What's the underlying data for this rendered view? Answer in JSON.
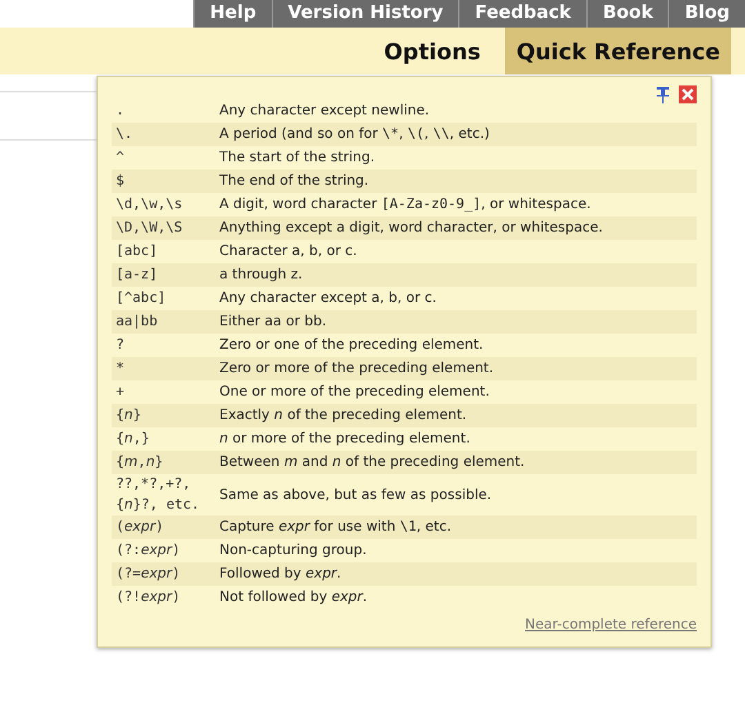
{
  "nav": [
    {
      "label": "Help"
    },
    {
      "label": "Version History"
    },
    {
      "label": "Feedback"
    },
    {
      "label": "Book"
    },
    {
      "label": "Blog"
    }
  ],
  "tabs": [
    {
      "label": "Options",
      "selected": false
    },
    {
      "label": "Quick Reference",
      "selected": true
    }
  ],
  "reference": {
    "rows": [
      {
        "pattern": [
          {
            "text": "."
          }
        ],
        "description": [
          {
            "text": "Any character except newline."
          }
        ]
      },
      {
        "pattern": [
          {
            "text": "\\."
          }
        ],
        "description": [
          {
            "text": "A period (and so on for "
          },
          {
            "text": "\\*",
            "code": true
          },
          {
            "text": ", "
          },
          {
            "text": "\\(",
            "code": true
          },
          {
            "text": ", "
          },
          {
            "text": "\\\\",
            "code": true
          },
          {
            "text": ", etc.)"
          }
        ]
      },
      {
        "pattern": [
          {
            "text": "^"
          }
        ],
        "description": [
          {
            "text": "The start of the string."
          }
        ]
      },
      {
        "pattern": [
          {
            "text": "$"
          }
        ],
        "description": [
          {
            "text": "The end of the string."
          }
        ]
      },
      {
        "pattern": [
          {
            "text": "\\d,\\w,\\s"
          }
        ],
        "description": [
          {
            "text": "A digit, word character "
          },
          {
            "text": "[A-Za-z0-9_]",
            "code": true
          },
          {
            "text": ", or whitespace."
          }
        ]
      },
      {
        "pattern": [
          {
            "text": "\\D,\\W,\\S"
          }
        ],
        "description": [
          {
            "text": "Anything except a digit, word character, or whitespace."
          }
        ]
      },
      {
        "pattern": [
          {
            "text": "[abc]"
          }
        ],
        "description": [
          {
            "text": "Character a, b, or c."
          }
        ]
      },
      {
        "pattern": [
          {
            "text": "[a-z]"
          }
        ],
        "description": [
          {
            "text": "a through z."
          }
        ]
      },
      {
        "pattern": [
          {
            "text": "[^abc]"
          }
        ],
        "description": [
          {
            "text": "Any character except a, b, or c."
          }
        ]
      },
      {
        "pattern": [
          {
            "text": "aa|bb"
          }
        ],
        "description": [
          {
            "text": "Either aa or bb."
          }
        ]
      },
      {
        "pattern": [
          {
            "text": "?"
          }
        ],
        "description": [
          {
            "text": "Zero or one of the preceding element."
          }
        ]
      },
      {
        "pattern": [
          {
            "text": "*"
          }
        ],
        "description": [
          {
            "text": "Zero or more of the preceding element."
          }
        ]
      },
      {
        "pattern": [
          {
            "text": "+"
          }
        ],
        "description": [
          {
            "text": "One or more of the preceding element."
          }
        ]
      },
      {
        "pattern": [
          {
            "text": "{"
          },
          {
            "text": "n",
            "italic": true
          },
          {
            "text": "}"
          }
        ],
        "description": [
          {
            "text": "Exactly "
          },
          {
            "text": "n",
            "italic": true
          },
          {
            "text": " of the preceding element."
          }
        ]
      },
      {
        "pattern": [
          {
            "text": "{"
          },
          {
            "text": "n",
            "italic": true
          },
          {
            "text": ",}"
          }
        ],
        "description": [
          {
            "text": "n",
            "italic": true
          },
          {
            "text": " or more of the preceding element."
          }
        ]
      },
      {
        "pattern": [
          {
            "text": "{"
          },
          {
            "text": "m",
            "italic": true
          },
          {
            "text": ","
          },
          {
            "text": "n",
            "italic": true
          },
          {
            "text": "}"
          }
        ],
        "description": [
          {
            "text": "Between "
          },
          {
            "text": "m",
            "italic": true
          },
          {
            "text": " and "
          },
          {
            "text": "n",
            "italic": true
          },
          {
            "text": " of the preceding element."
          }
        ]
      },
      {
        "pattern": [
          {
            "text": "??,*?,+?, {"
          },
          {
            "text": "n",
            "italic": true
          },
          {
            "text": "}?, etc."
          }
        ],
        "description": [
          {
            "text": "Same as above, but as few as possible."
          }
        ]
      },
      {
        "pattern": [
          {
            "text": "("
          },
          {
            "text": "expr",
            "italic": true
          },
          {
            "text": ")"
          }
        ],
        "description": [
          {
            "text": "Capture "
          },
          {
            "text": "expr",
            "italic": true
          },
          {
            "text": " for use with "
          },
          {
            "text": "\\1",
            "code": true
          },
          {
            "text": ", etc."
          }
        ]
      },
      {
        "pattern": [
          {
            "text": "(?:"
          },
          {
            "text": "expr",
            "italic": true
          },
          {
            "text": ")"
          }
        ],
        "description": [
          {
            "text": "Non-capturing group."
          }
        ]
      },
      {
        "pattern": [
          {
            "text": "(?="
          },
          {
            "text": "expr",
            "italic": true
          },
          {
            "text": ")"
          }
        ],
        "description": [
          {
            "text": "Followed by "
          },
          {
            "text": "expr",
            "italic": true
          },
          {
            "text": "."
          }
        ]
      },
      {
        "pattern": [
          {
            "text": "(?!"
          },
          {
            "text": "expr",
            "italic": true
          },
          {
            "text": ")"
          }
        ],
        "description": [
          {
            "text": "Not followed by "
          },
          {
            "text": "expr",
            "italic": true
          },
          {
            "text": "."
          }
        ]
      }
    ],
    "link": "Near-complete reference"
  }
}
